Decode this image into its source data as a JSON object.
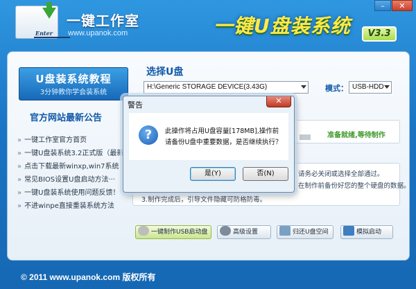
{
  "header": {
    "logo_text": "Enter",
    "brand_name": "一键工作室",
    "brand_url": "www.upanok.com",
    "app_title": "一键U盘装系统",
    "version": "V3.3",
    "minimize_label": "–",
    "close_label": "✕"
  },
  "sidebar": {
    "tutorial_title": "U盘装系统教程",
    "tutorial_subtitle": "3分钟教你学会装系统",
    "notice_title": "官方网站最新公告",
    "bullet": "»",
    "news": [
      "一键工作室官方首页",
      "一键U盘装系统3.2正式版（最新）",
      "点击下载最新winxp,win7系统",
      "常见BIOS设置U盘启动方法···",
      "一键U盘装系统使用问题反馈！",
      "不进winpe直接重装系统方法"
    ]
  },
  "main": {
    "select_disk_label": "选择U盘",
    "disk_value": "H:\\Generic STORAGE DEVICE(3.43G)",
    "mode_label": "模式：",
    "mode_value": "USB-HDD",
    "status_text": "准备就绪,等待制作",
    "notes": [
      "请务必关闭或选择全部通过。",
      "在制作前备份好您的整个硬盘的数据。",
      "3.制作完成后，引导文件隐藏可防格防毒。"
    ]
  },
  "actions": {
    "make_usb": "一键制作USB启动盘",
    "advanced": "高级设置",
    "restore": "归还U盘空间",
    "simulate": "模拟启动"
  },
  "footer": {
    "copyright": "© 2011 www.upanok.com",
    "rights": "版权所有"
  },
  "dialog": {
    "title": "警告",
    "close_label": "✕",
    "icon": "question-icon",
    "message_line1": "此操作将占用U盘容量[178MB],操作前",
    "message_line2": "请备份U盘中重要数据，是否继续执行？",
    "yes_label": "是(Y)",
    "no_label": "否(N)"
  },
  "colors": {
    "accent": "#1259a8",
    "title_yellow": "#ffe94a",
    "status_green": "#3f9a2a"
  }
}
